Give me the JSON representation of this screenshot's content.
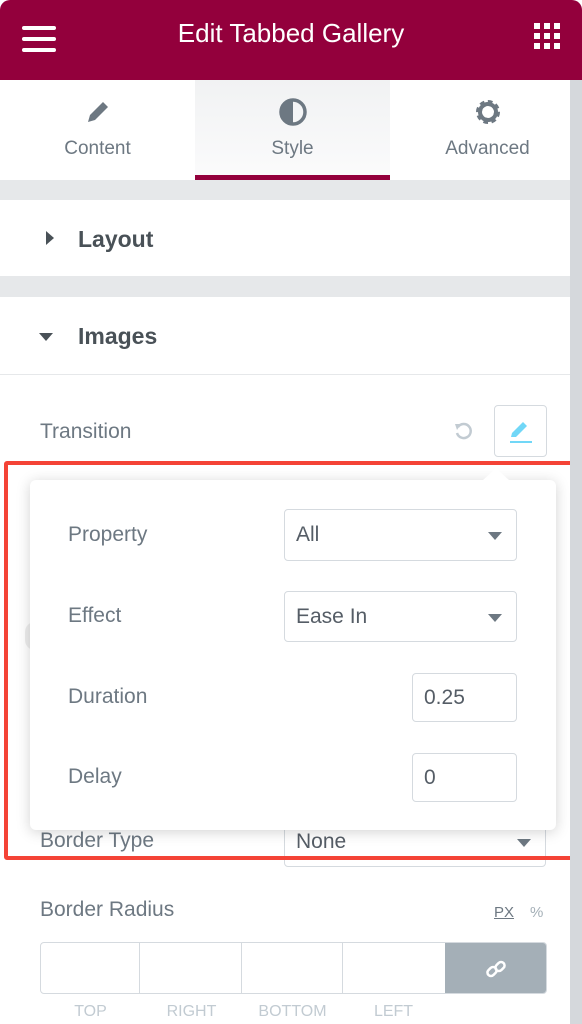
{
  "header": {
    "title": "Edit Tabbed Gallery",
    "menu_icon": "hamburger-icon",
    "apps_icon": "grid-icon"
  },
  "tabs": [
    {
      "label": "Content",
      "icon": "pencil-icon"
    },
    {
      "label": "Style",
      "icon": "contrast-icon",
      "active": true
    },
    {
      "label": "Advanced",
      "icon": "gear-icon"
    }
  ],
  "sections": {
    "layout": "Layout",
    "images": "Images"
  },
  "transition": {
    "label": "Transition"
  },
  "popover": {
    "property": {
      "label": "Property",
      "value": "All"
    },
    "effect": {
      "label": "Effect",
      "value": "Ease In"
    },
    "duration": {
      "label": "Duration",
      "value": "0.25"
    },
    "delay": {
      "label": "Delay",
      "value": "0"
    }
  },
  "border_type": {
    "label": "Border Type",
    "value": "None"
  },
  "border_radius": {
    "label": "Border Radius",
    "units": [
      "PX",
      "%"
    ],
    "fields": [
      "TOP",
      "RIGHT",
      "BOTTOM",
      "LEFT"
    ]
  },
  "colors": {
    "brand": "#93003c",
    "highlight": "#f44336",
    "accent": "#71d7f7"
  }
}
